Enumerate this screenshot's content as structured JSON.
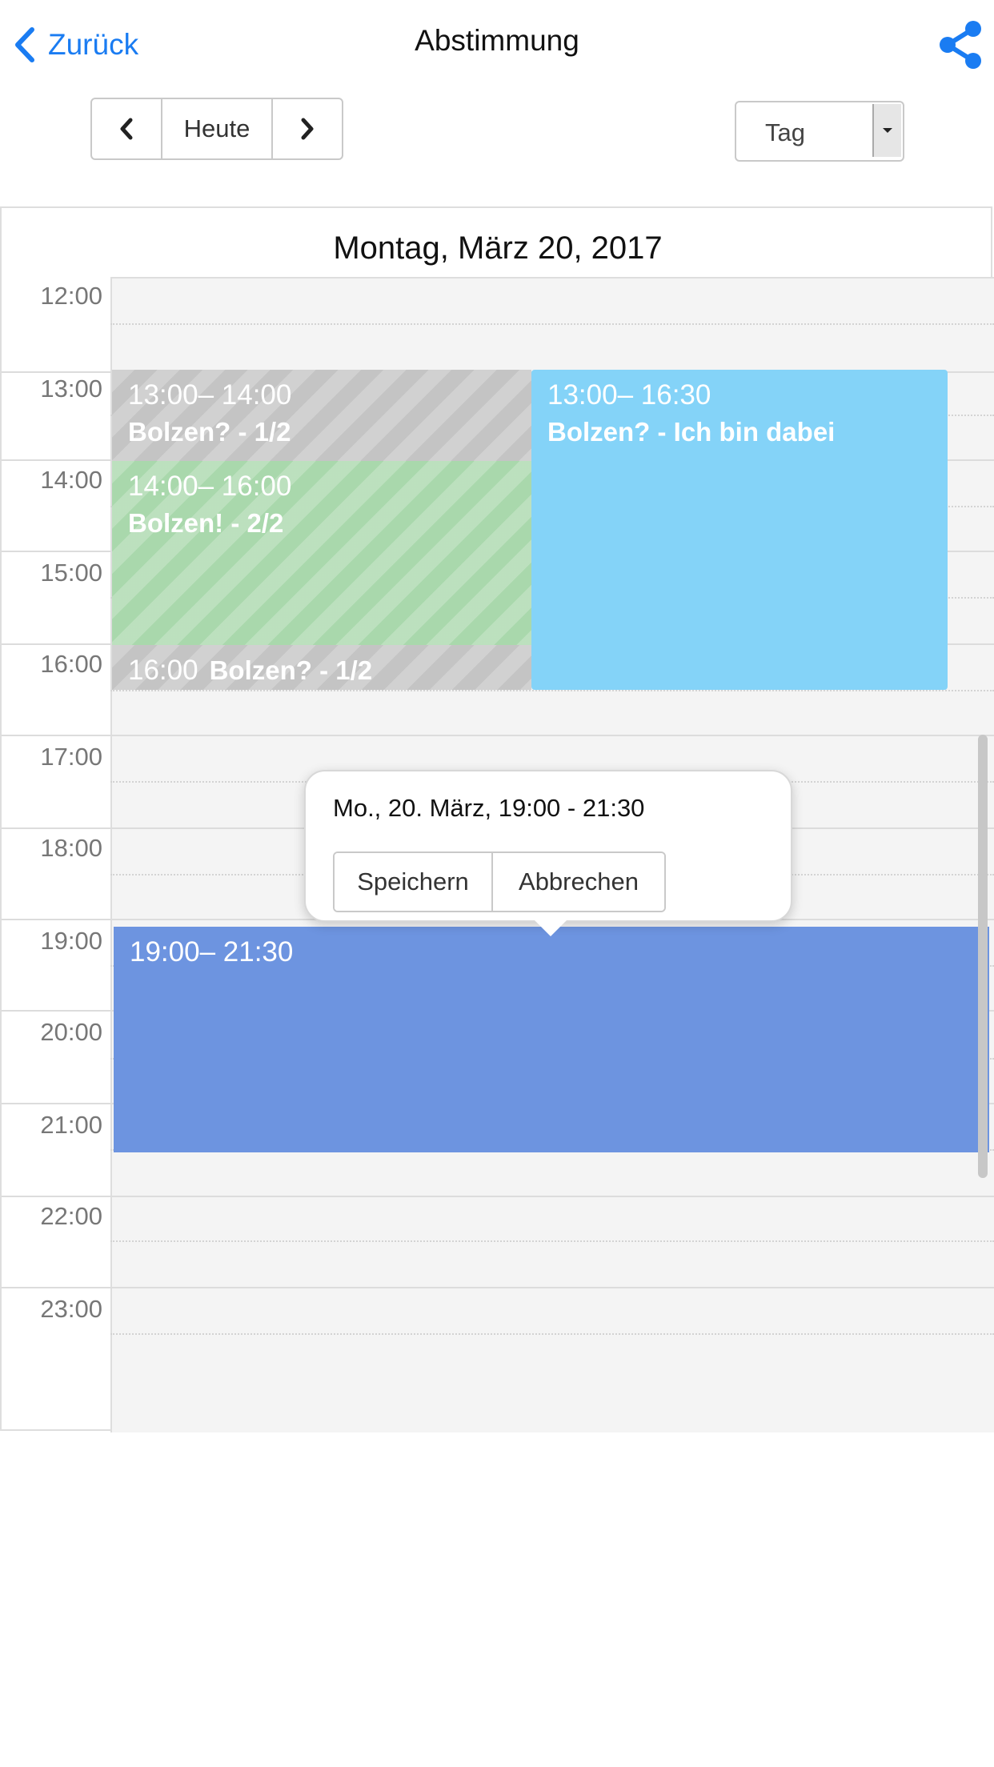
{
  "nav": {
    "back_label": "Zurück",
    "title": "Abstimmung",
    "share_icon": "share-icon",
    "accent_color": "#1a7cf2"
  },
  "toolbar": {
    "prev_icon": "chevron-left-icon",
    "today_label": "Heute",
    "next_icon": "chevron-right-icon",
    "view_select_value": "Tag"
  },
  "calendar": {
    "day_title": "Montag, März 20, 2017",
    "hours": [
      "12:00",
      "13:00",
      "14:00",
      "15:00",
      "16:00",
      "17:00",
      "18:00",
      "19:00",
      "20:00",
      "21:00",
      "22:00",
      "23:00"
    ],
    "events": [
      {
        "time": "13:00– 14:00",
        "title": "Bolzen? - 1/2",
        "color": "#c4c4c4"
      },
      {
        "time": "14:00– 16:00",
        "title": "Bolzen! - 2/2",
        "color": "#a9d8ac"
      },
      {
        "time": "16:00",
        "title": "Bolzen? - 1/2",
        "color": "#c4c4c4"
      },
      {
        "time": "13:00– 16:30",
        "title": "Bolzen? - Ich bin dabei",
        "color": "#84d3f8"
      },
      {
        "time": "19:00– 21:30",
        "title": "",
        "color": "#6d94e0"
      }
    ]
  },
  "popover": {
    "text": "Mo., 20. März, 19:00 - 21:30",
    "save_label": "Speichern",
    "cancel_label": "Abbrechen"
  }
}
